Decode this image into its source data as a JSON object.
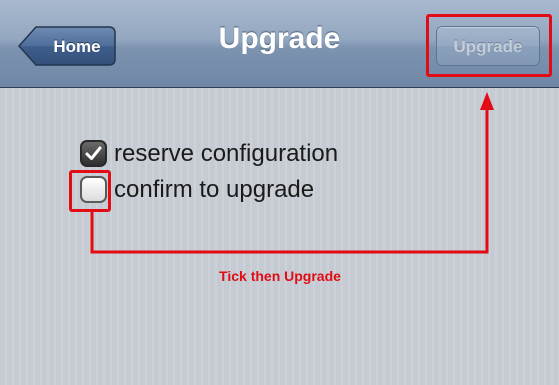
{
  "navbar": {
    "title": "Upgrade",
    "back_label": "Home",
    "action_label": "Upgrade",
    "action_enabled": false
  },
  "form": {
    "options": [
      {
        "label": "reserve configuration",
        "checked": true
      },
      {
        "label": "confirm to upgrade",
        "checked": false
      }
    ]
  },
  "annotation": {
    "caption": "Tick then Upgrade",
    "color": "#e10c14"
  },
  "colors": {
    "navbar_top": "#a9b9ce",
    "navbar_bottom": "#6f87a6",
    "background": "#c7cbd3"
  }
}
